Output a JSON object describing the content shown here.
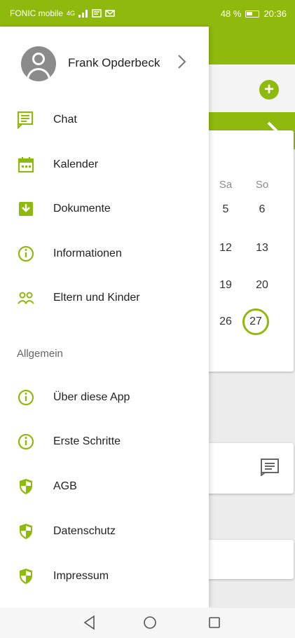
{
  "status_bar": {
    "carrier": "FONIC mobile",
    "network": "4G",
    "battery": "48 %",
    "time": "20:36"
  },
  "profile": {
    "name": "Frank Opderbeck"
  },
  "menu": [
    {
      "label": "Chat",
      "icon": "chat-icon"
    },
    {
      "label": "Kalender",
      "icon": "calendar-icon"
    },
    {
      "label": "Dokumente",
      "icon": "document-download-icon"
    },
    {
      "label": "Informationen",
      "icon": "info-icon"
    },
    {
      "label": "Eltern und Kinder",
      "icon": "people-icon"
    }
  ],
  "section_general": "Allgemein",
  "general_menu": [
    {
      "label": "Über diese App",
      "icon": "info-icon"
    },
    {
      "label": "Erste Schritte",
      "icon": "info-icon"
    },
    {
      "label": "AGB",
      "icon": "shield-icon"
    },
    {
      "label": "Datenschutz",
      "icon": "shield-icon"
    },
    {
      "label": "Impressum",
      "icon": "shield-icon"
    }
  ],
  "calendar": {
    "weekdays_visible": [
      "Sa",
      "So"
    ],
    "rows_visible": [
      [
        "5",
        "6"
      ],
      [
        "12",
        "13"
      ],
      [
        "19",
        "20"
      ],
      [
        "26",
        "27"
      ]
    ],
    "today": "27"
  },
  "colors": {
    "accent": "#8fba0d"
  }
}
